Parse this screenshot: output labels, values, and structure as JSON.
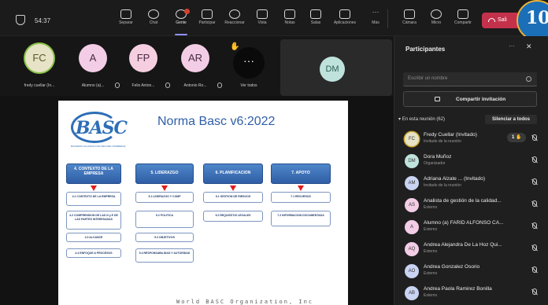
{
  "topbar": {
    "timer": "54:37",
    "items": [
      {
        "label": "Separar",
        "icon": "separate-icon"
      },
      {
        "label": "Chat",
        "icon": "chat-icon"
      },
      {
        "label": "Gente",
        "icon": "people-icon"
      },
      {
        "label": "Participar",
        "icon": "raise-hand-icon"
      },
      {
        "label": "Reaccionar",
        "icon": "react-icon"
      },
      {
        "label": "Vista",
        "icon": "view-icon"
      },
      {
        "label": "Notas",
        "icon": "notes-icon"
      },
      {
        "label": "Salas",
        "icon": "rooms-icon"
      },
      {
        "label": "Aplicaciones",
        "icon": "apps-icon"
      },
      {
        "label": "Más",
        "icon": "more-icon"
      },
      {
        "label": "Cámara",
        "icon": "camera-icon"
      },
      {
        "label": "Micro",
        "icon": "mic-icon"
      },
      {
        "label": "Compartir",
        "icon": "share-icon"
      }
    ],
    "leave_label": "Sali",
    "corner_badge": "10"
  },
  "strip": {
    "tiles": [
      {
        "initials": "FC",
        "name": "fredy cuellar (In...",
        "color": "#e6e3c6"
      },
      {
        "initials": "A",
        "name": "Alumno (a)...",
        "color": "#f3cde6"
      },
      {
        "initials": "FP",
        "name": "Felix Anton...",
        "color": "#f5cfe0"
      },
      {
        "initials": "AR",
        "name": "Antonio Ro...",
        "color": "#f3cde6"
      }
    ],
    "more_symbol": "···",
    "more_label": "Ver todos",
    "featured_initials": "DM"
  },
  "slide": {
    "logo_text": "BASC",
    "logo_tagline": "BUSINESS ALLIANCE FOR SECURE COMMERCE",
    "title": "Norma Basc v6:2022",
    "columns": [
      {
        "header": "4. CONTEXTO DE LA EMPRESA",
        "items": [
          "4.1 CONTEXTO DE LA EMPRESA",
          "4.2 COMPRENSION DE LAS N y E DE LAS PARTES INTERESADAS",
          "4.3 ALCANCE",
          "4.4 ENFOQUE A PROCESOS"
        ]
      },
      {
        "header": "5. LIDERAZGO",
        "items": [
          "5.1 LIDERAZGO Y COMP",
          "5.2 POLITICA",
          "5.3 OBJETIVOS",
          "5.4 RESPONSABILIDAD Y AUTORIDAD"
        ]
      },
      {
        "header": "6. PLANIFICACION",
        "items": [
          "6.1 GESTION DE RIESGOS",
          "6.2 REQUISITOS LEGALES"
        ]
      },
      {
        "header": "7. APOYO",
        "items": [
          "7.1 RECURSOS",
          "7.2 INFORMACION DOCUMENTADA"
        ]
      }
    ],
    "footer": "World BASC Organization, Inc"
  },
  "panel": {
    "title": "Participantes",
    "search_placeholder": "Escribir un nombre",
    "share_label": "Compartir invitación",
    "section_label": "En esta reunión (62)",
    "mute_all_label": "Silenciar a todos",
    "participants": [
      {
        "initials": "FC",
        "name": "Fredy Cuellar (Invitado)",
        "role": "Invitado de la reunión",
        "color": "#e6e3c6",
        "hand": "1"
      },
      {
        "initials": "DM",
        "name": "Dora Muñoz",
        "role": "Organizador",
        "color": "#bfe2dc"
      },
      {
        "initials": "AM",
        "name": "Adriana Alzate ...  (Invitado)",
        "role": "Invitado de la reunión",
        "color": "#c9d3f2"
      },
      {
        "initials": "AS",
        "name": "Analista de gestión de la calidad...",
        "role": "Externo",
        "color": "#f3cde6"
      },
      {
        "initials": "A",
        "name": "Alumno (a) FARID ALFONSO CA...",
        "role": "Externo",
        "color": "#f3cde6"
      },
      {
        "initials": "AQ",
        "name": "Andrea Alejandra De La Hoz Qui...",
        "role": "Externo",
        "color": "#f3cde6"
      },
      {
        "initials": "AO",
        "name": "Andrea Gonzalez Osorio",
        "role": "Externo",
        "color": "#c9d3f2"
      },
      {
        "initials": "AB",
        "name": "Andrea Paola Ramirez Bonilla",
        "role": "Externo",
        "color": "#c9d3f2"
      }
    ]
  }
}
